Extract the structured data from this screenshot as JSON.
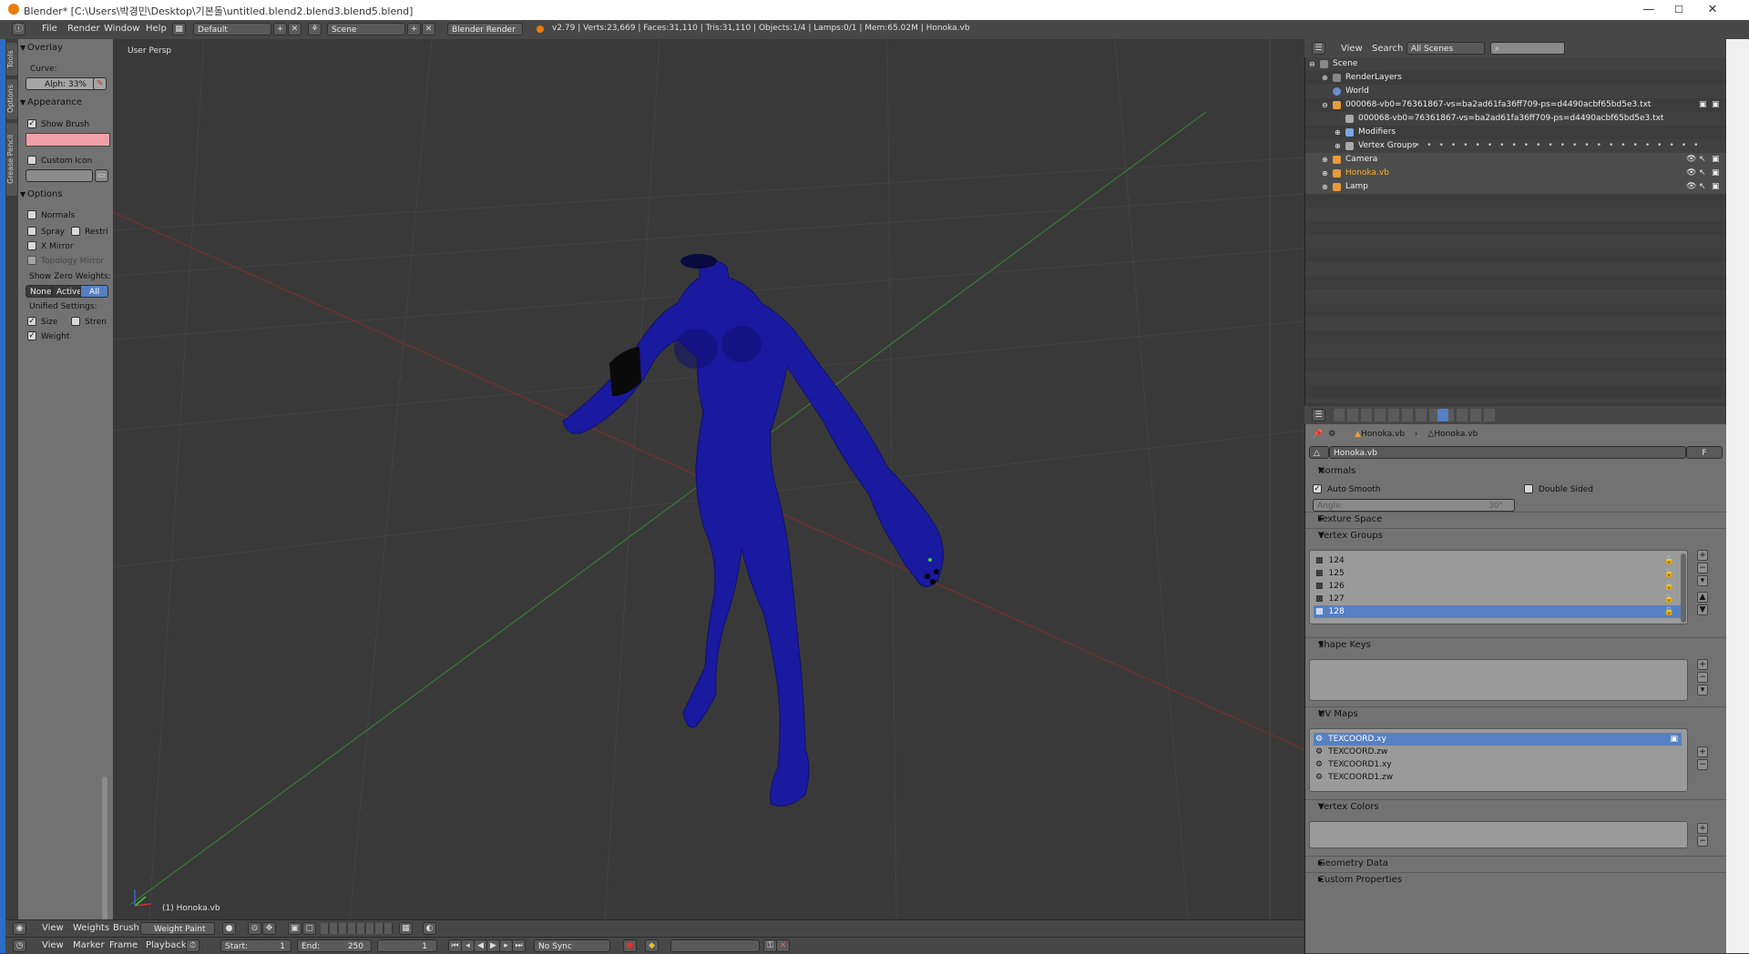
{
  "window": {
    "title": "Blender* [C:\\Users\\박경민\\Desktop\\기본돌\\untitled.blend2.blend3.blend5.blend]",
    "minimize": "—",
    "maximize": "☐",
    "close": "✕"
  },
  "topmenu": {
    "items": [
      "File",
      "Render",
      "Window",
      "Help"
    ],
    "layout": "Default",
    "scene": "Scene",
    "engine": "Blender Render",
    "stats": "v2.79 | Verts:23,669 | Faces:31,110 | Tris:31,110 | Objects:1/4 | Lamps:0/1 | Mem:65.02M | Honoka.vb"
  },
  "tabs": [
    "Tools",
    "Options",
    "Grease Pencil"
  ],
  "toolshelf": {
    "overlay": "Overlay",
    "curve": "Curve:",
    "alpha": "Alph: 33%",
    "appearance": "Appearance",
    "show_brush": "Show Brush",
    "brush_color": "#f0a0a8",
    "custom_icon": "Custom Icon",
    "options": "Options",
    "normals": "Normals",
    "spray": "Spray",
    "restrict": "Restri",
    "x_mirror": "X Mirror",
    "topology_mirror": "Topology Mirror",
    "show_zero_weights": "Show Zero Weights:",
    "zero_none": "None",
    "zero_active": "Active",
    "zero_all": "All",
    "unified_settings": "Unified Settings:",
    "size": "Size",
    "strength": "Stren",
    "weight": "Weight"
  },
  "viewport": {
    "label": "User Persp",
    "object_label": "(1) Honoka.vb",
    "mesh_color": "#1a1aa0"
  },
  "vpheader": {
    "items": [
      "View",
      "Weights",
      "Brush"
    ],
    "mode": "Weight Paint"
  },
  "timeline": {
    "items": [
      "View",
      "Marker",
      "Frame",
      "Playback"
    ],
    "start": "Start:",
    "start_val": "1",
    "end": "End:",
    "end_val": "250",
    "current": "1",
    "sync": "No Sync"
  },
  "outliner": {
    "view": "View",
    "search": "Search",
    "filter": "All Scenes",
    "rows": [
      {
        "label": "Scene",
        "indent": 0
      },
      {
        "label": "RenderLayers",
        "indent": 1
      },
      {
        "label": "World",
        "indent": 1
      },
      {
        "label": "000068-vb0=76361867-vs=ba2ad61fa36ff709-ps=d4490acbf65bd5e3.txt",
        "indent": 1
      },
      {
        "label": "000068-vb0=76361867-vs=ba2ad61fa36ff709-ps=d4490acbf65bd5e3.txt",
        "indent": 2
      },
      {
        "label": "Modifiers",
        "indent": 2
      },
      {
        "label": "Vertex Groups",
        "indent": 2
      },
      {
        "label": "Camera",
        "indent": 1
      },
      {
        "label": "Honoka.vb",
        "indent": 1
      },
      {
        "label": "Lamp",
        "indent": 1
      }
    ]
  },
  "properties": {
    "breadcrumb_a": "Honoka.vb",
    "breadcrumb_b": "Honoka.vb",
    "mesh_name": "Honoka.vb",
    "fake_user": "F",
    "normals": "Normals",
    "auto_smooth": "Auto Smooth",
    "double_sided": "Double Sided",
    "angle": "Angle:",
    "angle_val": "30°",
    "texture_space": "Texture Space",
    "vertex_groups": "Vertex Groups",
    "groups": [
      "124",
      "125",
      "126",
      "127",
      "128"
    ],
    "shape_keys": "Shape Keys",
    "uv_maps": "UV Maps",
    "uvs": [
      "TEXCOORD.xy",
      "TEXCOORD.zw",
      "TEXCOORD1.xy",
      "TEXCOORD1.zw"
    ],
    "vertex_colors": "Vertex Colors",
    "geometry_data": "Geometry Data",
    "custom_properties": "Custom Properties"
  }
}
